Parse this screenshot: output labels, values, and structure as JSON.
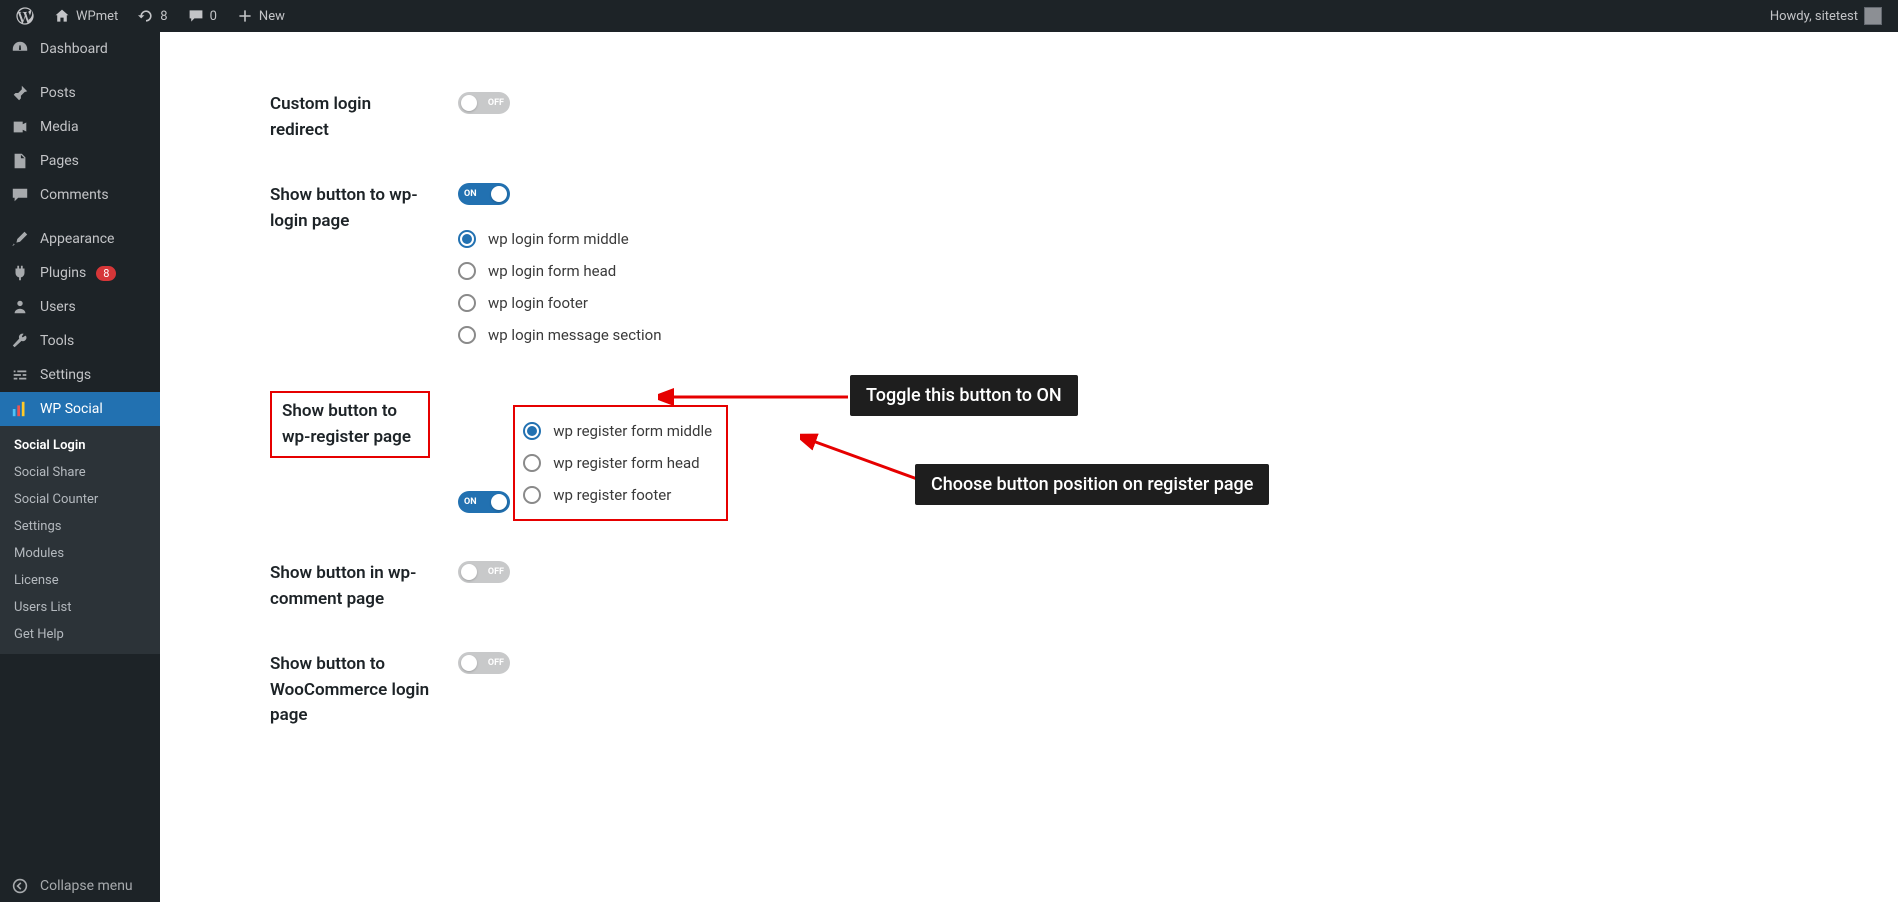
{
  "adminbar": {
    "site": "WPmet",
    "updates": "8",
    "comments": "0",
    "new": "New",
    "howdy": "Howdy, sitetest"
  },
  "sidebar": {
    "dashboard": "Dashboard",
    "posts": "Posts",
    "media": "Media",
    "pages": "Pages",
    "comments": "Comments",
    "appearance": "Appearance",
    "plugins": "Plugins",
    "plugins_badge": "8",
    "users": "Users",
    "tools": "Tools",
    "settings": "Settings",
    "wpsocial": "WP Social",
    "sub": {
      "login": "Social Login",
      "share": "Social Share",
      "counter": "Social Counter",
      "settings": "Settings",
      "modules": "Modules",
      "license": "License",
      "userslist": "Users List",
      "help": "Get Help"
    },
    "collapse": "Collapse menu"
  },
  "toggle": {
    "on": "ON",
    "off": "OFF"
  },
  "settings": {
    "custom_redirect": {
      "label": "Custom login redirect",
      "on": false
    },
    "login_page": {
      "label": "Show button to wp-login page",
      "on": true,
      "selected": 0,
      "options": [
        "wp login form middle",
        "wp login form head",
        "wp login footer",
        "wp login message section"
      ]
    },
    "register_page": {
      "label": "Show button to wp-register page",
      "on": true,
      "selected": 0,
      "options": [
        "wp register form middle",
        "wp register form head",
        "wp register footer"
      ]
    },
    "comment_page": {
      "label": "Show button in wp-comment page",
      "on": false
    },
    "woo_page": {
      "label": "Show button to WooCommerce login page",
      "on": false
    }
  },
  "annotations": {
    "toggle": "Toggle this button to ON",
    "position": "Choose button position on register page"
  }
}
